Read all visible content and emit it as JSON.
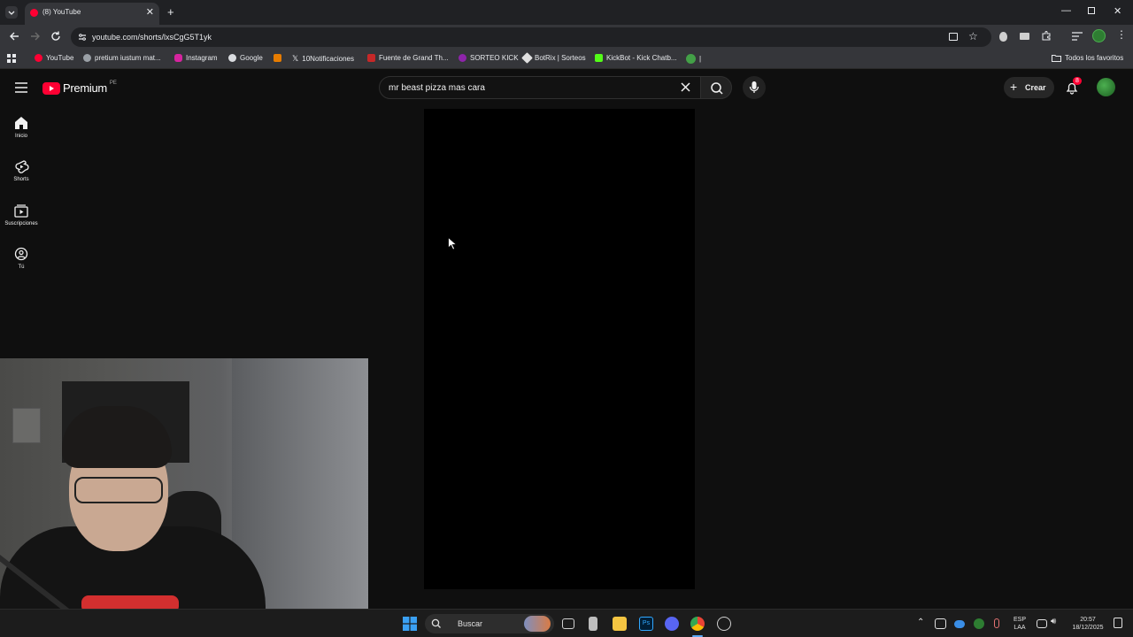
{
  "browser": {
    "tab_title": "(8) YouTube",
    "url": "youtube.com/shorts/lxsCgG5T1yk",
    "bookmarks": [
      "YouTube",
      "pretium iustum mat...",
      "Instagram",
      "Google",
      "10Notificaciones",
      "Fuente de Grand Th...",
      "SORTEO KICK",
      "BotRix | Sorteos",
      "KickBot - Kick Chatb...",
      "|"
    ],
    "all_favorites": "Todos los favoritos"
  },
  "youtube": {
    "logo_text": "Premium",
    "region": "PE",
    "search_query": "mr beast pizza mas cara",
    "create_label": "Crear",
    "notifications_count": "8",
    "nav": [
      {
        "label": "Inicio"
      },
      {
        "label": "Shorts"
      },
      {
        "label": "Suscripciones"
      },
      {
        "label": "Tú"
      }
    ]
  },
  "taskbar": {
    "search_label": "Buscar",
    "lang_line1": "ESP",
    "lang_line2": "LAA",
    "time": "20:57",
    "date": "18/12/2025"
  },
  "colors": {
    "youtube_red": "#ff0033",
    "background": "#0f0f0f",
    "notification_badge": "#ff0033"
  }
}
